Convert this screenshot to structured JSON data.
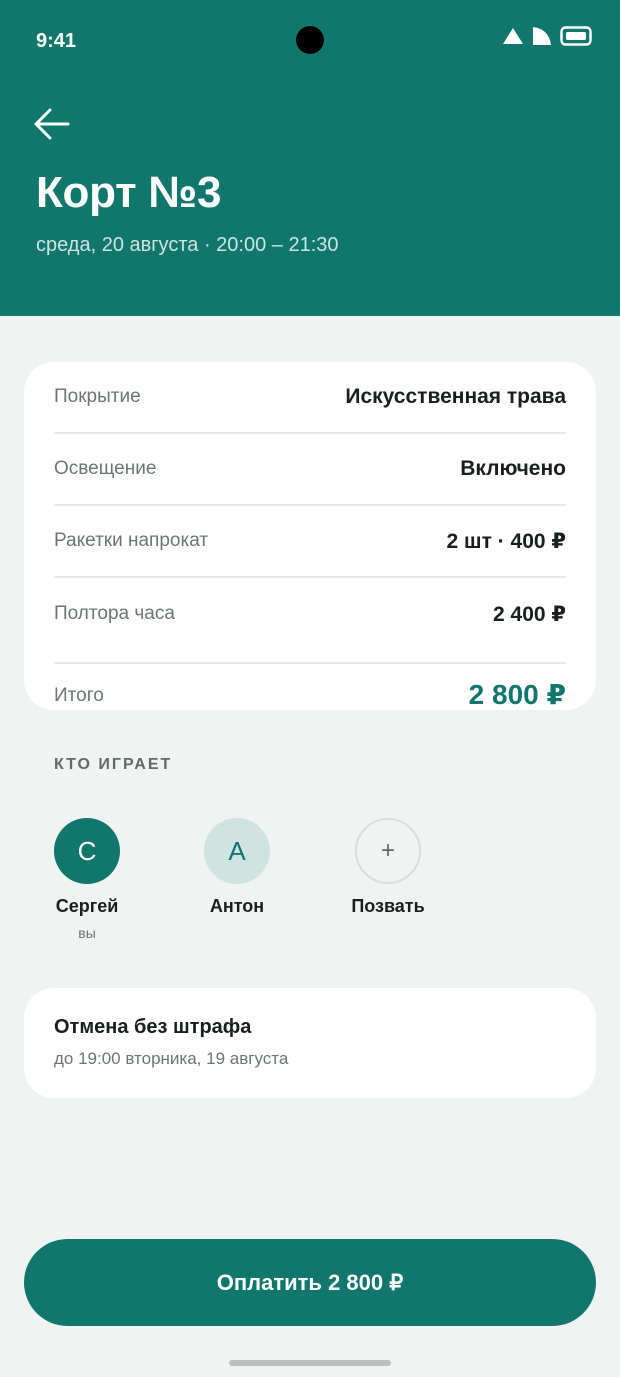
{
  "status_bar": {
    "time": "9:41"
  },
  "header": {
    "title": "Корт №3",
    "subtitle": "среда, 20 августа · 20:00 – 21:30"
  },
  "details": {
    "rows": [
      {
        "label": "Покрытие",
        "value": "Искусственная трава"
      },
      {
        "label": "Освещение",
        "value": "Включено"
      },
      {
        "label": "Ракетки напрокат",
        "value": "2 шт · 400 ₽"
      },
      {
        "label": "Полтора часа",
        "value": "2 400 ₽"
      }
    ],
    "total_label": "Итого",
    "total_value": "2 800 ₽"
  },
  "players": {
    "section_label": "КТО ИГРАЕТ",
    "items": [
      {
        "initial": "С",
        "name": "Сергей",
        "sub": "вы"
      },
      {
        "initial": "А",
        "name": "Антон"
      }
    ],
    "invite_label": "Позвать",
    "invite_symbol": "+"
  },
  "cancellation": {
    "title": "Отмена без штрафа",
    "subtitle": "до 19:00 вторника, 19 августа"
  },
  "pay_button": {
    "label": "Оплатить 2 800 ₽"
  },
  "colors": {
    "accent": "#10766e",
    "accent_light": "#cfe4e1",
    "background": "#eff3f2"
  },
  "icons": [
    "back-arrow-icon",
    "signal-icon",
    "network-icon",
    "battery-icon",
    "plus-icon"
  ]
}
